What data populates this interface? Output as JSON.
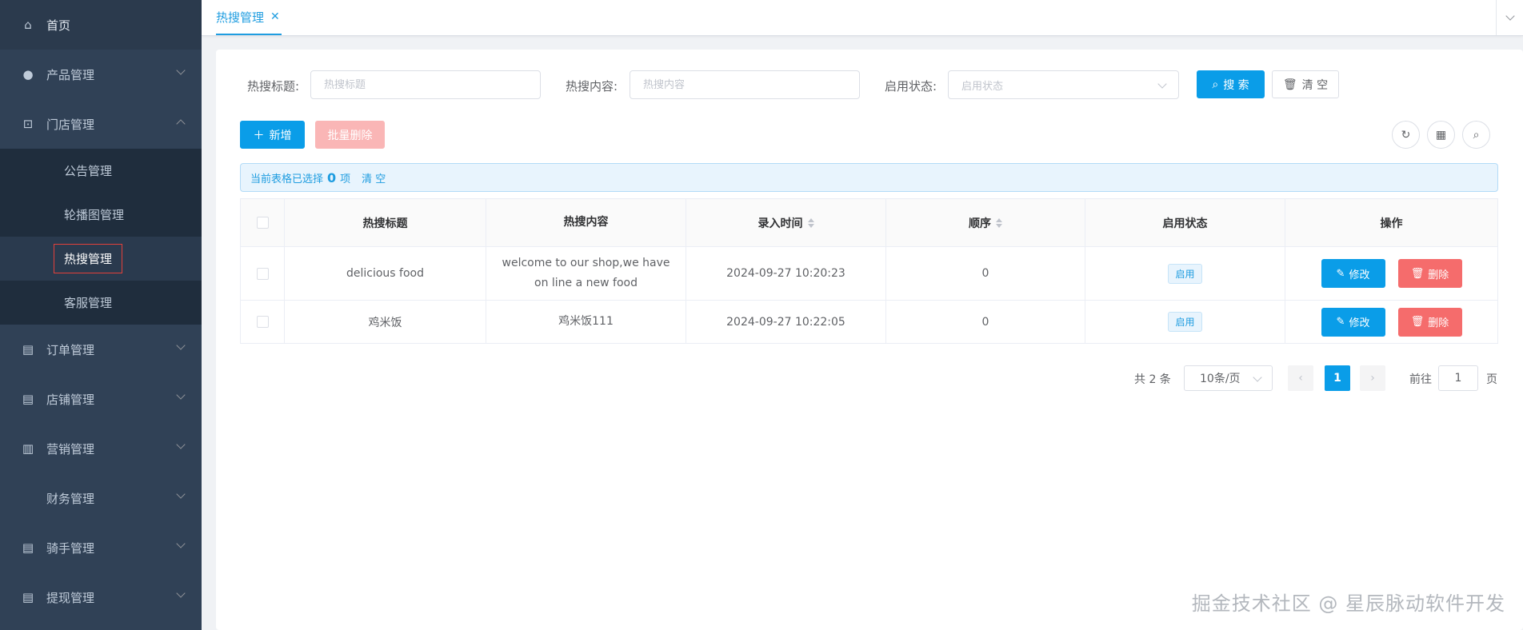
{
  "sidebar": {
    "items": [
      {
        "label": "首页",
        "icon": "home-icon",
        "glyph": "⌂"
      },
      {
        "label": "产品管理",
        "icon": "user-icon",
        "glyph": "●"
      },
      {
        "label": "门店管理",
        "icon": "store-icon",
        "glyph": "⊡"
      },
      {
        "label": "订单管理",
        "icon": "document-icon",
        "glyph": "▤"
      },
      {
        "label": "店铺管理",
        "icon": "document-icon",
        "glyph": "▤"
      },
      {
        "label": "营销管理",
        "icon": "bar-chart-icon",
        "glyph": "▥"
      },
      {
        "label": "财务管理",
        "icon": "",
        "glyph": ""
      },
      {
        "label": "骑手管理",
        "icon": "document-icon",
        "glyph": "▤"
      },
      {
        "label": "提现管理",
        "icon": "document-icon",
        "glyph": "▤"
      }
    ],
    "submenu": [
      {
        "label": "公告管理"
      },
      {
        "label": "轮播图管理"
      },
      {
        "label": "热搜管理"
      },
      {
        "label": "客服管理"
      }
    ]
  },
  "tabs": [
    {
      "label": "热搜管理",
      "close": "✕"
    }
  ],
  "search": {
    "title_label": "热搜标题:",
    "title_placeholder": "热搜标题",
    "content_label": "热搜内容:",
    "content_placeholder": "热搜内容",
    "status_label": "启用状态:",
    "status_placeholder": "启用状态",
    "search_btn": "搜 索",
    "clear_btn": "清 空"
  },
  "toolbar": {
    "add_btn": "新增",
    "batch_delete_btn": "批量删除"
  },
  "selection": {
    "prefix": "当前表格已选择",
    "count": "0",
    "suffix": "项",
    "clear": "清 空"
  },
  "table": {
    "columns": [
      "热搜标题",
      "热搜内容",
      "录入时间",
      "顺序",
      "启用状态",
      "操作"
    ],
    "rows": [
      {
        "title": "delicious food",
        "content": "welcome to our shop,we have on line a new food",
        "time": "2024-09-27 10:20:23",
        "order": "0",
        "status": "启用"
      },
      {
        "title": "鸡米饭",
        "content": "鸡米饭111",
        "time": "2024-09-27 10:22:05",
        "order": "0",
        "status": "启用"
      }
    ],
    "edit_label": "修改",
    "delete_label": "删除"
  },
  "pagination": {
    "total": "共 2 条",
    "page_size": "10条/页",
    "current": "1",
    "goto_label": "前往",
    "goto_value": "1",
    "page_suffix": "页"
  },
  "watermark": "掘金技术社区 @ 星辰脉动软件开发",
  "colors": {
    "primary": "#0a9de8",
    "danger": "#f56c6c",
    "sidebar": "#304156"
  }
}
